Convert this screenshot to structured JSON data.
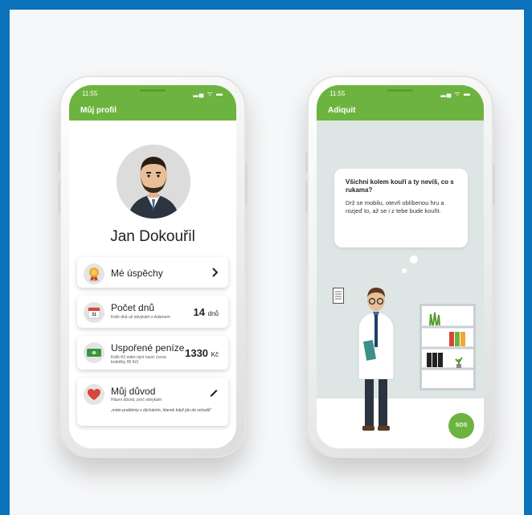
{
  "profile_screen": {
    "status_time": "11:55",
    "status_icons": "▂▄ ᯤ ▬",
    "app_title": "Můj profil",
    "user_name": "Jan Dokouřil",
    "cards": {
      "achievements": {
        "title": "Mé úspěchy"
      },
      "days": {
        "title": "Počet dnů",
        "subtitle": "Kolik dnů už odvykám s Adamem",
        "value": "14",
        "unit": "dnů",
        "calendar_label": "31"
      },
      "savings": {
        "title": "Uspořené peníze",
        "subtitle": "Kolik Kč mám nyní navíc (cena krabičky 95 Kč)",
        "value": "1330",
        "unit": "Kč"
      },
      "reason": {
        "title": "Můj důvod",
        "subtitle": "Hlavní důvod, proč odvykám",
        "quote": "„mám problémy s dýcháním, hlavně když jdu do schodů\""
      }
    }
  },
  "adiquit_screen": {
    "status_time": "11:55",
    "status_icons": "▂▄ ᯤ ▬",
    "app_title": "Adiquit",
    "bubble_title": "Všichni kolem kouří a ty nevíš, co s rukama?",
    "bubble_body": "Drž se mobilu, otevři oblíbenou hru a rozjeď to, až se i z tebe bude kouřit.",
    "sos_label": "SOS"
  },
  "colors": {
    "frame_blue": "#0b72bb",
    "app_green": "#6db33f",
    "scene_bg": "#dde6e4"
  },
  "icons": [
    "medal-icon",
    "calendar-icon",
    "money-icon",
    "heart-icon",
    "chevron-right-icon",
    "pencil-icon"
  ]
}
